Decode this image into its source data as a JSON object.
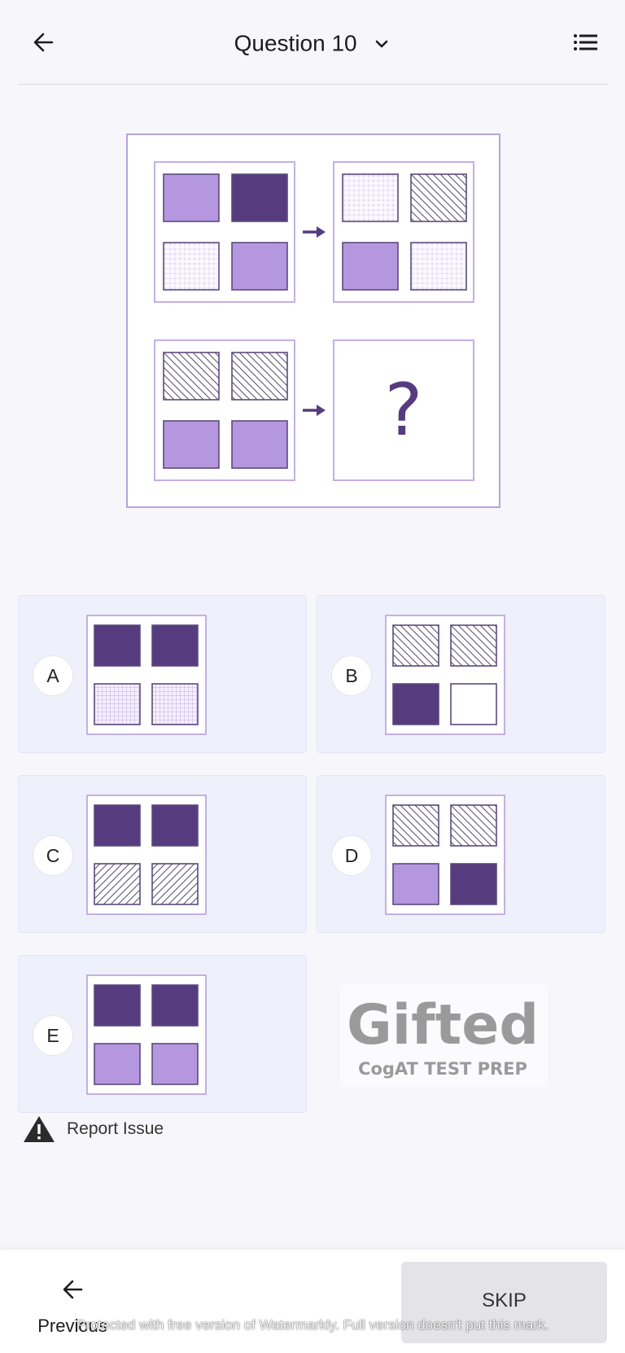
{
  "header": {
    "title": "Question 10",
    "back_icon": "arrow-left-icon",
    "dropdown_icon": "chevron-down-icon",
    "menu_icon": "list-icon"
  },
  "colors": {
    "light_purple": "#b597df",
    "dark_purple": "#563c7f",
    "panel_border": "#c4b0e5",
    "option_background": "#eef0fb"
  },
  "question": {
    "top_pair": {
      "left": [
        "light",
        "dark",
        "dots",
        "light"
      ],
      "right": [
        "dots",
        "stripes",
        "light",
        "dots"
      ]
    },
    "bottom_pair": {
      "left": [
        "stripes",
        "stripes",
        "light",
        "light"
      ],
      "right_label": "?"
    }
  },
  "options": [
    {
      "letter": "A",
      "cells": [
        "dark",
        "dark",
        "grid",
        "grid"
      ]
    },
    {
      "letter": "B",
      "cells": [
        "stripes",
        "stripes",
        "dark",
        "white"
      ]
    },
    {
      "letter": "C",
      "cells": [
        "dark",
        "dark",
        "rstripes",
        "rstripes"
      ]
    },
    {
      "letter": "D",
      "cells": [
        "stripes",
        "stripes",
        "light",
        "dark"
      ]
    },
    {
      "letter": "E",
      "cells": [
        "dark",
        "dark",
        "light",
        "light"
      ]
    }
  ],
  "logo": {
    "brand": "Gifted",
    "tagline": "CogAT TEST PREP"
  },
  "report": {
    "label": "Report Issue",
    "icon": "warning-icon"
  },
  "footer": {
    "previous_label": "Previous",
    "skip_label": "SKIP",
    "watermark": "Protected with free version of Watermarkly. Full version doesn't put this mark."
  }
}
